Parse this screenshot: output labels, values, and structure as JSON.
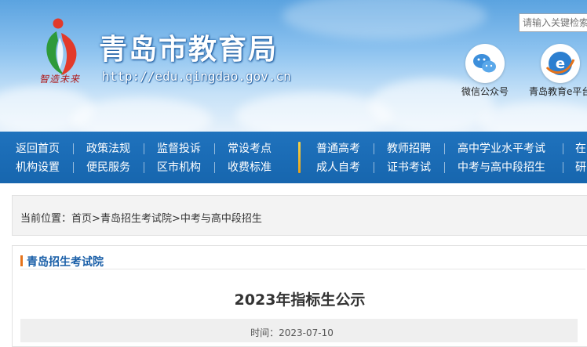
{
  "header": {
    "logo_slogan": "智造未来",
    "title": "青岛市教育局",
    "url": "http://edu.qingdao.gov.cn",
    "search_placeholder": "请输入关键检索",
    "wechat_label": "微信公众号",
    "platform_label": "青岛教育e平台"
  },
  "nav": {
    "row1": [
      "返回首页",
      "政策法规",
      "监督投诉",
      "常设考点",
      "普通高考",
      "教师招聘",
      "高中学业水平考试",
      "在"
    ],
    "row2": [
      "机构设置",
      "便民服务",
      "区市机构",
      "收费标准",
      "成人自考",
      "证书考试",
      "中考与高中段招生",
      "研"
    ]
  },
  "breadcrumb": {
    "prefix": "当前位置：",
    "home": "首页",
    "sep1": ">",
    "level1": "青岛招生考试院",
    "sep2": ">",
    "level2": "中考与高中段招生"
  },
  "section": {
    "title": "青岛招生考试院"
  },
  "article": {
    "title": "2023年指标生公示",
    "time_label": "时间：",
    "time_value": "2023-07-10"
  },
  "colors": {
    "nav_bg": "#1766ae",
    "accent_orange": "#e5731b",
    "section_blue": "#1a5fa8",
    "nav_divider": "#f2d34b"
  }
}
